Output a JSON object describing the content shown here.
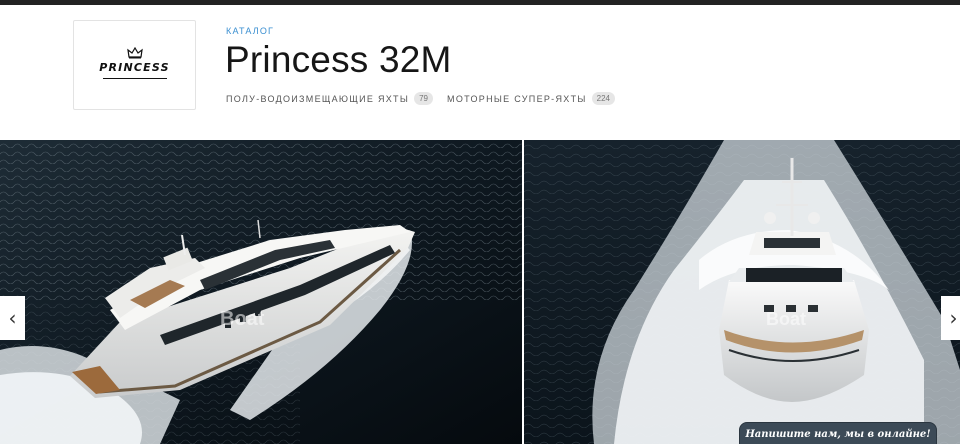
{
  "brand": {
    "logo_text": "PRINCESS"
  },
  "breadcrumb": {
    "catalog_label": "КАТАЛОГ"
  },
  "page": {
    "title": "Princess 32M"
  },
  "tags": [
    {
      "label": "ПОЛУ-ВОДОИЗМЕЩАЮЩИЕ ЯХТЫ",
      "count": "79"
    },
    {
      "label": "МОТОРНЫЕ СУПЕР-ЯХТЫ",
      "count": "224"
    }
  ],
  "gallery": {
    "watermark_left": "Boat",
    "watermark_right": "Boat",
    "prev_icon": "chevron-left-icon",
    "next_icon": "chevron-right-icon",
    "prev_glyph": "‹",
    "next_glyph": "›"
  },
  "chat": {
    "label": "Напишите нам, мы в онлайне!"
  },
  "colors": {
    "accent": "#3a8fd1",
    "chat_bg": "#3c4a57",
    "sea": "#0d1a26"
  }
}
